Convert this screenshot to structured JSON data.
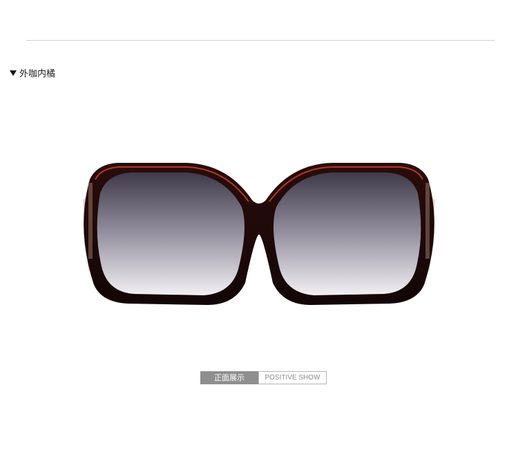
{
  "section": {
    "title": "外咖内橘",
    "icon": "triangle-down-icon"
  },
  "photo": {
    "subject": "sunglasses-front-view"
  },
  "caption": {
    "cn_label": "正面展示",
    "en_label": "POSITIVE SHOW"
  }
}
